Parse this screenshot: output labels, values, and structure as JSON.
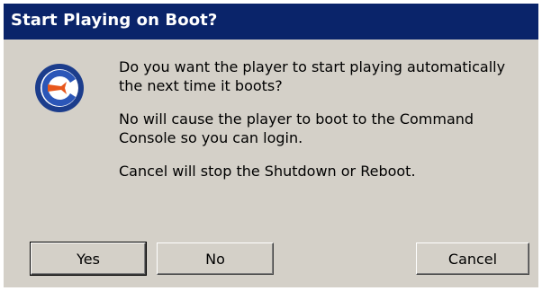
{
  "window": {
    "title": "Start Playing on Boot?"
  },
  "dialog": {
    "icon": "player-logo-icon",
    "message_lines": [
      "Do you want the player to start playing automatically",
      "the next time it boots?",
      "No will cause the player to boot to the Command",
      "Console so you can login.",
      "Cancel will stop the Shutdown or Reboot."
    ]
  },
  "buttons": {
    "yes": "Yes",
    "no": "No",
    "cancel": "Cancel"
  },
  "colors": {
    "titlebar": "#0a246a",
    "dialog_bg": "#d4d0c8",
    "icon_blue": "#1c3d8c",
    "icon_orange": "#e8571c"
  }
}
